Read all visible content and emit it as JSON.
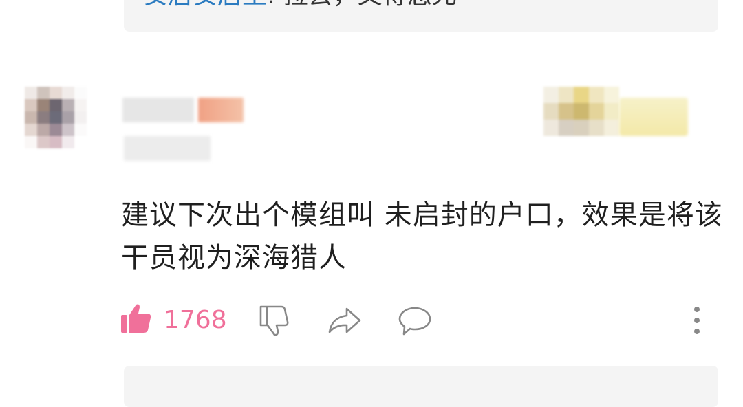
{
  "previous_reply": {
    "user": "安居安居王",
    "text": ": 拉去，又得怎死"
  },
  "comment": {
    "text": "建议下次出个模组叫 未启封的户口，效果是将该干员视为深海猎人",
    "likes": "1768"
  },
  "icons": {
    "like": "thumbs-up-icon",
    "dislike": "thumbs-down-icon",
    "share": "share-icon",
    "reply": "comment-bubble-icon",
    "more": "more-vertical-icon"
  },
  "colors": {
    "like_accent": "#f0709a",
    "username_link": "#2b7bc0",
    "reply_background": "#f4f4f4"
  }
}
